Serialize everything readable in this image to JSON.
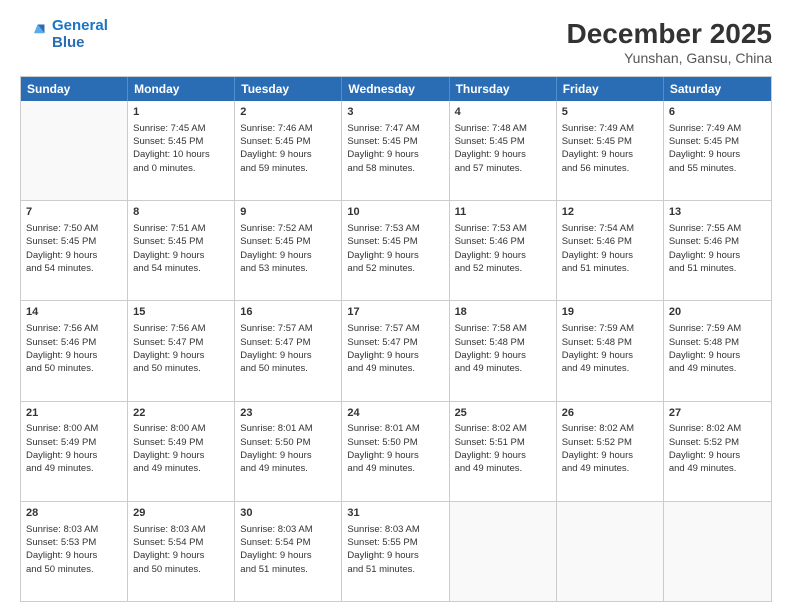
{
  "header": {
    "logo_line1": "General",
    "logo_line2": "Blue",
    "month": "December 2025",
    "location": "Yunshan, Gansu, China"
  },
  "days_of_week": [
    "Sunday",
    "Monday",
    "Tuesday",
    "Wednesday",
    "Thursday",
    "Friday",
    "Saturday"
  ],
  "weeks": [
    [
      {
        "day": "",
        "content": ""
      },
      {
        "day": "1",
        "content": "Sunrise: 7:45 AM\nSunset: 5:45 PM\nDaylight: 10 hours\nand 0 minutes."
      },
      {
        "day": "2",
        "content": "Sunrise: 7:46 AM\nSunset: 5:45 PM\nDaylight: 9 hours\nand 59 minutes."
      },
      {
        "day": "3",
        "content": "Sunrise: 7:47 AM\nSunset: 5:45 PM\nDaylight: 9 hours\nand 58 minutes."
      },
      {
        "day": "4",
        "content": "Sunrise: 7:48 AM\nSunset: 5:45 PM\nDaylight: 9 hours\nand 57 minutes."
      },
      {
        "day": "5",
        "content": "Sunrise: 7:49 AM\nSunset: 5:45 PM\nDaylight: 9 hours\nand 56 minutes."
      },
      {
        "day": "6",
        "content": "Sunrise: 7:49 AM\nSunset: 5:45 PM\nDaylight: 9 hours\nand 55 minutes."
      }
    ],
    [
      {
        "day": "7",
        "content": "Sunrise: 7:50 AM\nSunset: 5:45 PM\nDaylight: 9 hours\nand 54 minutes."
      },
      {
        "day": "8",
        "content": "Sunrise: 7:51 AM\nSunset: 5:45 PM\nDaylight: 9 hours\nand 54 minutes."
      },
      {
        "day": "9",
        "content": "Sunrise: 7:52 AM\nSunset: 5:45 PM\nDaylight: 9 hours\nand 53 minutes."
      },
      {
        "day": "10",
        "content": "Sunrise: 7:53 AM\nSunset: 5:45 PM\nDaylight: 9 hours\nand 52 minutes."
      },
      {
        "day": "11",
        "content": "Sunrise: 7:53 AM\nSunset: 5:46 PM\nDaylight: 9 hours\nand 52 minutes."
      },
      {
        "day": "12",
        "content": "Sunrise: 7:54 AM\nSunset: 5:46 PM\nDaylight: 9 hours\nand 51 minutes."
      },
      {
        "day": "13",
        "content": "Sunrise: 7:55 AM\nSunset: 5:46 PM\nDaylight: 9 hours\nand 51 minutes."
      }
    ],
    [
      {
        "day": "14",
        "content": "Sunrise: 7:56 AM\nSunset: 5:46 PM\nDaylight: 9 hours\nand 50 minutes."
      },
      {
        "day": "15",
        "content": "Sunrise: 7:56 AM\nSunset: 5:47 PM\nDaylight: 9 hours\nand 50 minutes."
      },
      {
        "day": "16",
        "content": "Sunrise: 7:57 AM\nSunset: 5:47 PM\nDaylight: 9 hours\nand 50 minutes."
      },
      {
        "day": "17",
        "content": "Sunrise: 7:57 AM\nSunset: 5:47 PM\nDaylight: 9 hours\nand 49 minutes."
      },
      {
        "day": "18",
        "content": "Sunrise: 7:58 AM\nSunset: 5:48 PM\nDaylight: 9 hours\nand 49 minutes."
      },
      {
        "day": "19",
        "content": "Sunrise: 7:59 AM\nSunset: 5:48 PM\nDaylight: 9 hours\nand 49 minutes."
      },
      {
        "day": "20",
        "content": "Sunrise: 7:59 AM\nSunset: 5:48 PM\nDaylight: 9 hours\nand 49 minutes."
      }
    ],
    [
      {
        "day": "21",
        "content": "Sunrise: 8:00 AM\nSunset: 5:49 PM\nDaylight: 9 hours\nand 49 minutes."
      },
      {
        "day": "22",
        "content": "Sunrise: 8:00 AM\nSunset: 5:49 PM\nDaylight: 9 hours\nand 49 minutes."
      },
      {
        "day": "23",
        "content": "Sunrise: 8:01 AM\nSunset: 5:50 PM\nDaylight: 9 hours\nand 49 minutes."
      },
      {
        "day": "24",
        "content": "Sunrise: 8:01 AM\nSunset: 5:50 PM\nDaylight: 9 hours\nand 49 minutes."
      },
      {
        "day": "25",
        "content": "Sunrise: 8:02 AM\nSunset: 5:51 PM\nDaylight: 9 hours\nand 49 minutes."
      },
      {
        "day": "26",
        "content": "Sunrise: 8:02 AM\nSunset: 5:52 PM\nDaylight: 9 hours\nand 49 minutes."
      },
      {
        "day": "27",
        "content": "Sunrise: 8:02 AM\nSunset: 5:52 PM\nDaylight: 9 hours\nand 49 minutes."
      }
    ],
    [
      {
        "day": "28",
        "content": "Sunrise: 8:03 AM\nSunset: 5:53 PM\nDaylight: 9 hours\nand 50 minutes."
      },
      {
        "day": "29",
        "content": "Sunrise: 8:03 AM\nSunset: 5:54 PM\nDaylight: 9 hours\nand 50 minutes."
      },
      {
        "day": "30",
        "content": "Sunrise: 8:03 AM\nSunset: 5:54 PM\nDaylight: 9 hours\nand 51 minutes."
      },
      {
        "day": "31",
        "content": "Sunrise: 8:03 AM\nSunset: 5:55 PM\nDaylight: 9 hours\nand 51 minutes."
      },
      {
        "day": "",
        "content": ""
      },
      {
        "day": "",
        "content": ""
      },
      {
        "day": "",
        "content": ""
      }
    ]
  ]
}
